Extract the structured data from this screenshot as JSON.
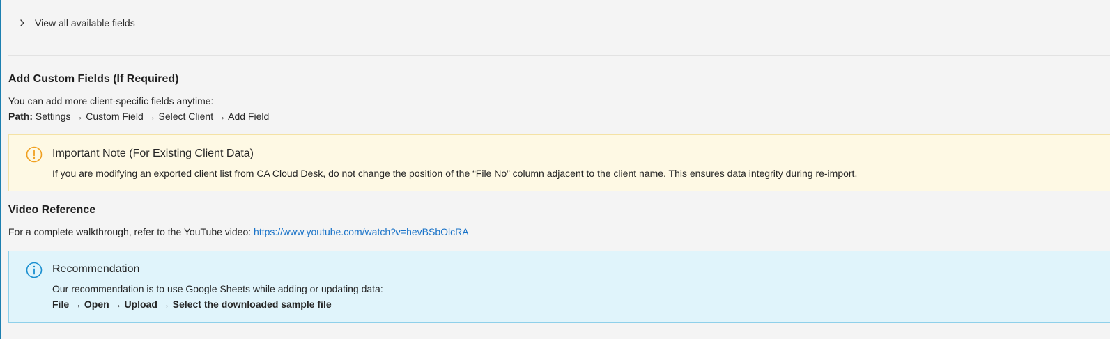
{
  "collapse": {
    "label": "View all available fields"
  },
  "custom_fields": {
    "heading": "Add Custom Fields (If Required)",
    "intro": "You can add more client-specific fields anytime:",
    "path_label": "Path:",
    "path_value": "Settings → Custom Field → Select Client → Add Field"
  },
  "important_note": {
    "title": "Important Note (For Existing Client Data)",
    "text": "If you are modifying an exported client list from CA Cloud Desk, do not change the position of the “File No” column adjacent to the client name. This ensures data integrity during re-import.",
    "icon": "exclamation-circle-icon",
    "accent": "#f0a020"
  },
  "video": {
    "heading": "Video Reference",
    "text": "For a complete walkthrough, refer to the YouTube video:",
    "link_text": "https://www.youtube.com/watch?v=hevBSbOlcRA"
  },
  "recommendation": {
    "title": "Recommendation",
    "text": "Our recommendation is to use Google Sheets while adding or updating data:",
    "steps": "File → Open → Upload → Select the downloaded sample file",
    "icon": "info-circle-icon",
    "accent": "#1a8fd0"
  }
}
